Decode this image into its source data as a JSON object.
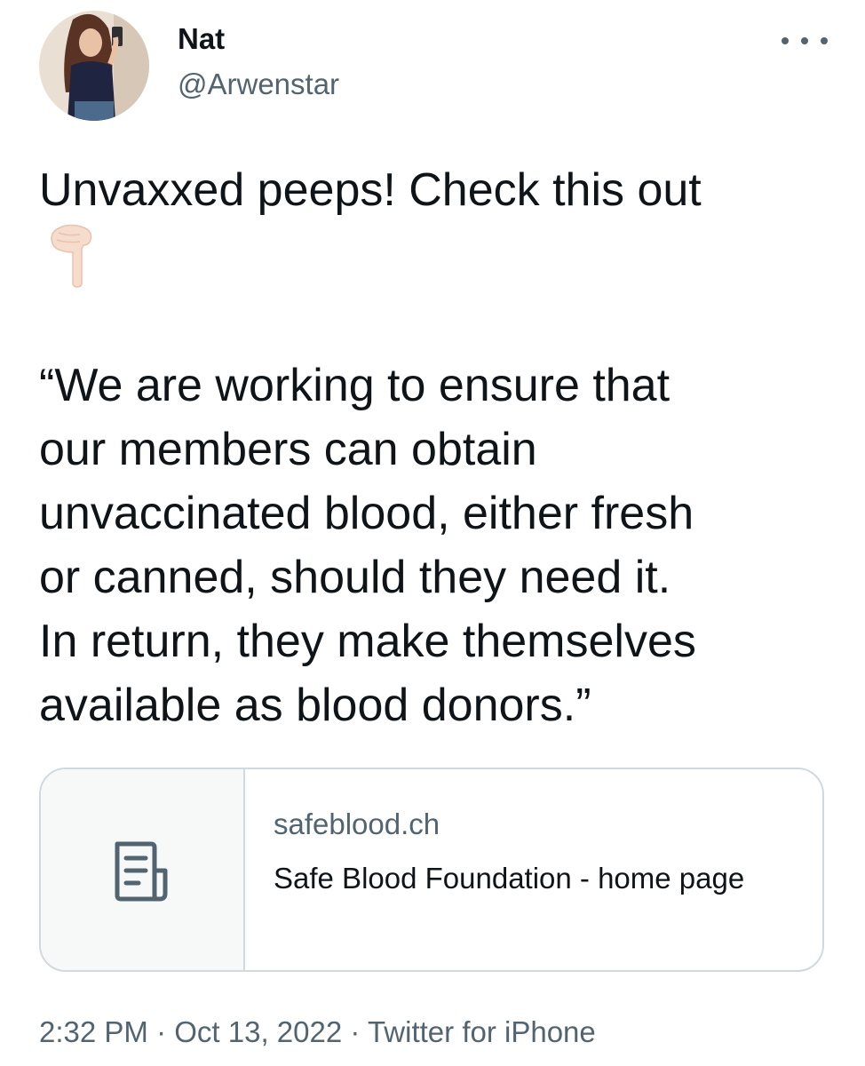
{
  "tweet": {
    "author": {
      "display_name": "Nat",
      "handle": "@Arwenstar",
      "avatar_icon": "user-avatar-photo"
    },
    "more_icon": "more-options-icon",
    "text_lines": {
      "line1": "Unvaxxed peeps! Check this out",
      "emoji": "👇🏻",
      "line3": "“We are working to ensure that",
      "line4": "our members can obtain",
      "line5": "unvaccinated blood, either fresh",
      "line6": "or canned, should they need it.",
      "line7": "In return, they make themselves",
      "line8": "available as blood donors.”"
    },
    "link_card": {
      "icon": "document-icon",
      "domain": "safeblood.ch",
      "title": "Safe Blood Foundation - home page"
    },
    "meta": {
      "time": "2:32 PM",
      "separator": "·",
      "date": "Oct 13, 2022",
      "source": "Twitter for iPhone"
    }
  },
  "colors": {
    "text": "#0f1419",
    "secondary": "#536471",
    "border": "#cfd9de"
  }
}
